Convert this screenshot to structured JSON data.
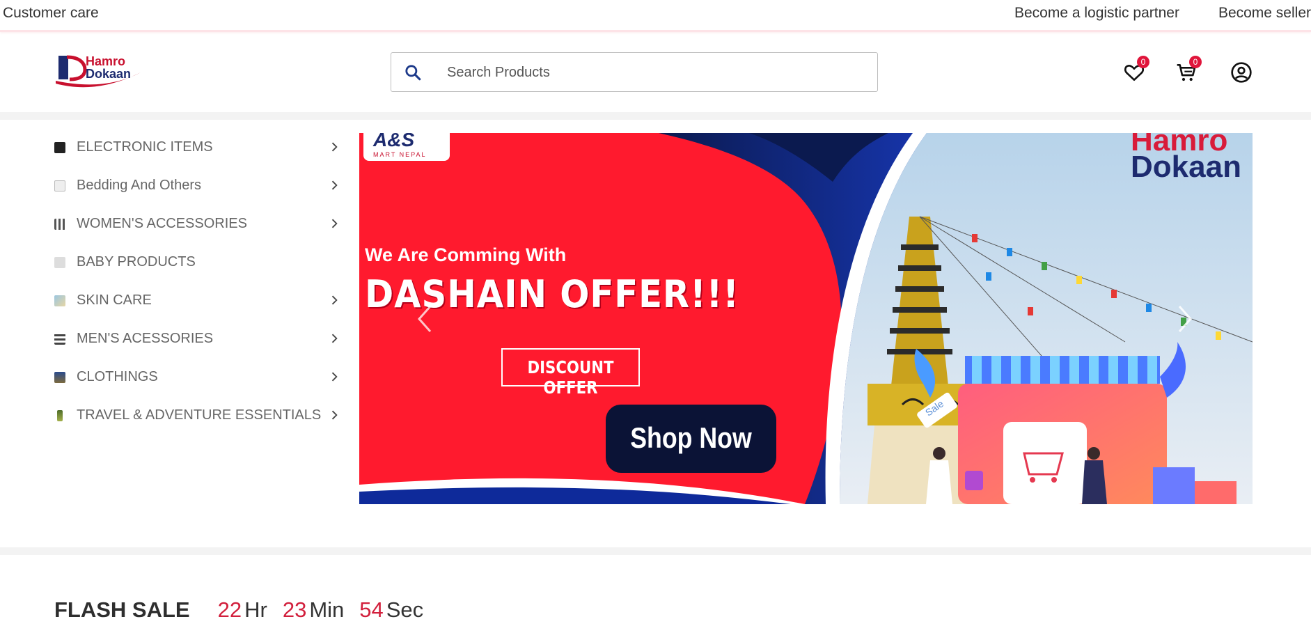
{
  "topbar": {
    "customer_care": "Customer care",
    "logistic_partner": "Become a logistic partner",
    "become_seller": "Become seller"
  },
  "header": {
    "logo_line1": "Hamro",
    "logo_line2": "Dokaan",
    "search_placeholder": "Search Products",
    "wishlist_count": "0",
    "cart_count": "0",
    "icons": [
      "search-icon",
      "heart-icon",
      "cart-icon",
      "user-icon"
    ]
  },
  "categories": [
    {
      "label": "ELECTRONIC ITEMS",
      "has_sub": true
    },
    {
      "label": "Bedding And Others",
      "has_sub": true
    },
    {
      "label": "WOMEN'S ACCESSORIES",
      "has_sub": true
    },
    {
      "label": "BABY PRODUCTS",
      "has_sub": false
    },
    {
      "label": "SKIN CARE",
      "has_sub": true
    },
    {
      "label": "MEN'S ACESSORIES",
      "has_sub": true
    },
    {
      "label": "CLOTHINGS",
      "has_sub": true
    },
    {
      "label": "TRAVEL & ADVENTURE ESSENTIALS",
      "has_sub": true
    }
  ],
  "banner": {
    "headline": "We Are Comming With",
    "offer": "DASHAIN OFFER!!!",
    "discount": "DISCOUNT OFFER",
    "cta": "Shop Now",
    "brand_line1": "Hamro",
    "brand_line2": "Dokaan",
    "partner_logo": "A&S",
    "partner_sub": "MART NEPAL",
    "sale_tag": "Sale"
  },
  "flash_sale": {
    "title": "FLASH SALE",
    "hours": "22",
    "hours_unit": "Hr",
    "minutes": "23",
    "minutes_unit": "Min",
    "seconds": "54",
    "seconds_unit": "Sec"
  },
  "colors": {
    "accent_red": "#d21f3c",
    "brand_navy": "#1d2b6f",
    "banner_red": "#ff1a2e"
  }
}
